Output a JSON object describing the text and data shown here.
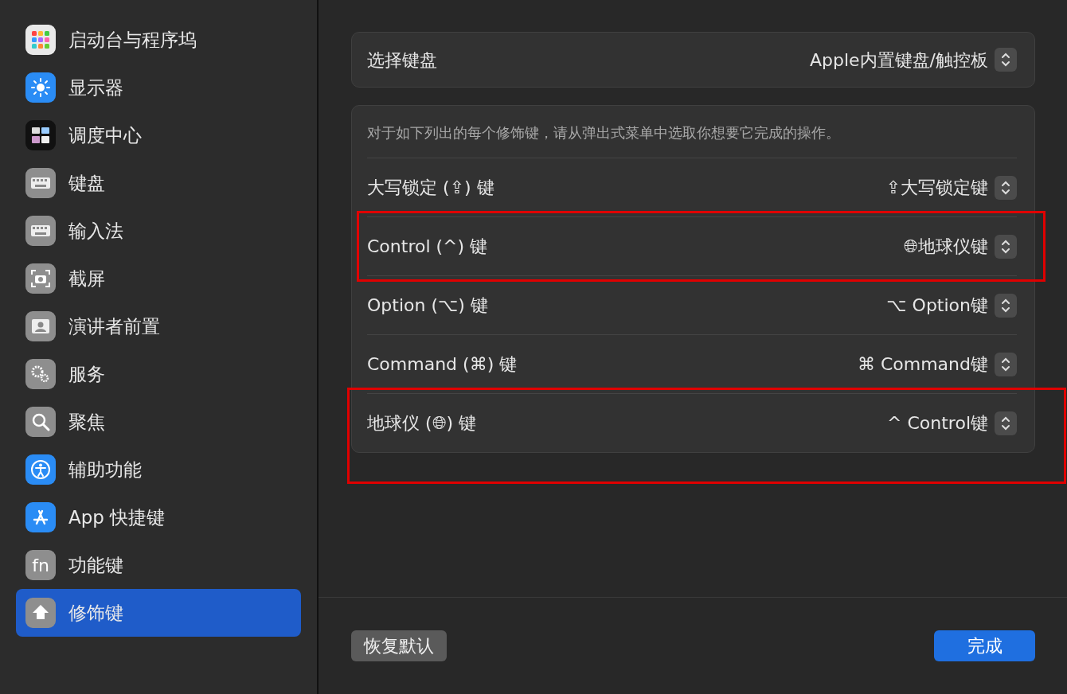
{
  "sidebar": {
    "items": [
      {
        "label": "启动台与程序坞",
        "kind": "launchpad",
        "selected": false
      },
      {
        "label": "显示器",
        "kind": "display",
        "selected": false
      },
      {
        "label": "调度中心",
        "kind": "mission",
        "selected": false
      },
      {
        "label": "键盘",
        "kind": "keyboard",
        "selected": false
      },
      {
        "label": "输入法",
        "kind": "keyboard",
        "selected": false
      },
      {
        "label": "截屏",
        "kind": "camera",
        "selected": false
      },
      {
        "label": "演讲者前置",
        "kind": "person",
        "selected": false
      },
      {
        "label": "服务",
        "kind": "gears",
        "selected": false
      },
      {
        "label": "聚焦",
        "kind": "search",
        "selected": false
      },
      {
        "label": "辅助功能",
        "kind": "accessibility",
        "selected": false
      },
      {
        "label": "App 快捷键",
        "kind": "appstore",
        "selected": false
      },
      {
        "label": "功能键",
        "kind": "fn",
        "icon_text": "fn",
        "selected": false
      },
      {
        "label": "修饰键",
        "kind": "arrow",
        "selected": true
      }
    ]
  },
  "keyboard_select": {
    "label": "选择键盘",
    "value": "Apple内置键盘/触控板"
  },
  "modifiers": {
    "description": "对于如下列出的每个修饰键，请从弹出式菜单中选取你想要它完成的操作。",
    "rows": [
      {
        "label": "大写锁定 (⇪) 键",
        "value": "⇪大写锁定键",
        "highlighted": false
      },
      {
        "label": "Control (^) 键",
        "value": "🌐︎地球仪键",
        "highlighted": true
      },
      {
        "label": "Option (⌥) 键",
        "value": "⌥ Option键",
        "highlighted": false
      },
      {
        "label": "Command (⌘) 键",
        "value": "⌘ Command键",
        "highlighted": false
      },
      {
        "label": "地球仪 (🌐︎) 键",
        "value": "^ Control键",
        "highlighted": true
      }
    ]
  },
  "buttons": {
    "restore": "恢复默认",
    "done": "完成"
  }
}
